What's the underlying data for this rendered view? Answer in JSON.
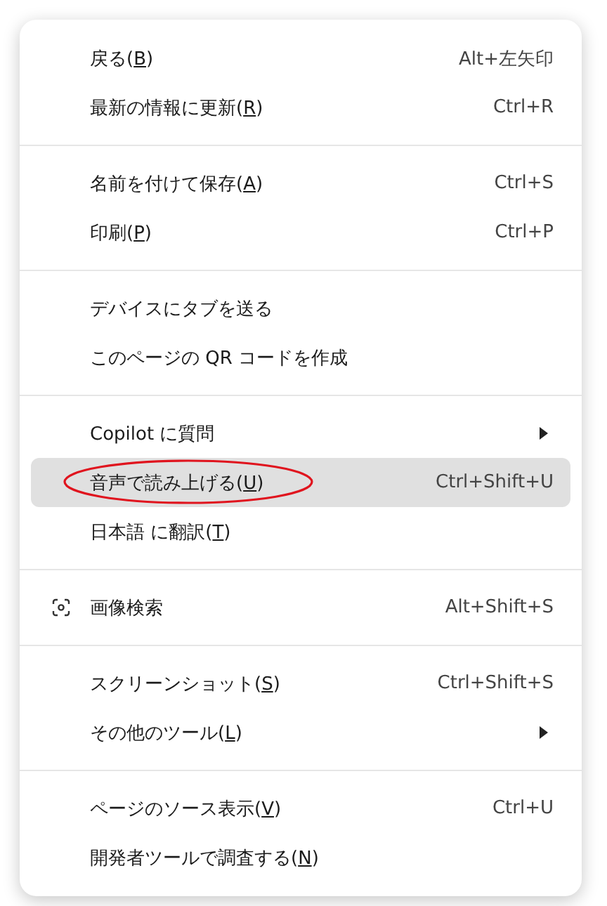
{
  "menu": {
    "groups": [
      {
        "items": [
          {
            "kind": "plain",
            "before": "戻る(",
            "key": "B",
            "after": ")",
            "shortcut": "Alt+左矢印",
            "submenu": false,
            "highlighted": false,
            "circled": false
          },
          {
            "kind": "plain",
            "before": "最新の情報に更新(",
            "key": "R",
            "after": ")",
            "shortcut": "Ctrl+R",
            "submenu": false,
            "highlighted": false,
            "circled": false
          }
        ]
      },
      {
        "items": [
          {
            "kind": "plain",
            "before": "名前を付けて保存(",
            "key": "A",
            "after": ")",
            "shortcut": "Ctrl+S",
            "submenu": false,
            "highlighted": false,
            "circled": false
          },
          {
            "kind": "plain",
            "before": "印刷(",
            "key": "P",
            "after": ")",
            "shortcut": "Ctrl+P",
            "submenu": false,
            "highlighted": false,
            "circled": false
          }
        ]
      },
      {
        "items": [
          {
            "kind": "plain",
            "before": "デバイスにタブを送る",
            "submenu": false,
            "highlighted": false,
            "circled": false
          },
          {
            "kind": "plain",
            "before": "このページの QR コードを作成",
            "submenu": false,
            "highlighted": false,
            "circled": false
          }
        ]
      },
      {
        "items": [
          {
            "kind": "plain",
            "before": "Copilot に質問",
            "submenu": true,
            "highlighted": false,
            "circled": false
          },
          {
            "kind": "plain",
            "before": "音声で読み上げる(",
            "key": "U",
            "after": ")",
            "shortcut": "Ctrl+Shift+U",
            "submenu": false,
            "highlighted": true,
            "circled": true
          },
          {
            "kind": "plain",
            "before": "日本語 に翻訳(",
            "key": "T",
            "after": ")",
            "submenu": false,
            "highlighted": false,
            "circled": false
          }
        ]
      },
      {
        "items": [
          {
            "kind": "visual-search",
            "before": "画像検索",
            "shortcut": "Alt+Shift+S",
            "submenu": false,
            "highlighted": false,
            "circled": false
          }
        ]
      },
      {
        "items": [
          {
            "kind": "plain",
            "before": "スクリーンショット(",
            "key": "S",
            "after": ")",
            "shortcut": "Ctrl+Shift+S",
            "submenu": false,
            "highlighted": false,
            "circled": false
          },
          {
            "kind": "plain",
            "before": "その他のツール(",
            "key": "L",
            "after": ")",
            "submenu": true,
            "highlighted": false,
            "circled": false
          }
        ]
      },
      {
        "items": [
          {
            "kind": "plain",
            "before": "ページのソース表示(",
            "key": "V",
            "after": ")",
            "shortcut": "Ctrl+U",
            "submenu": false,
            "highlighted": false,
            "circled": false
          },
          {
            "kind": "plain",
            "before": "開発者ツールで調査する(",
            "key": "N",
            "after": ")",
            "submenu": false,
            "highlighted": false,
            "circled": false
          }
        ]
      }
    ]
  }
}
